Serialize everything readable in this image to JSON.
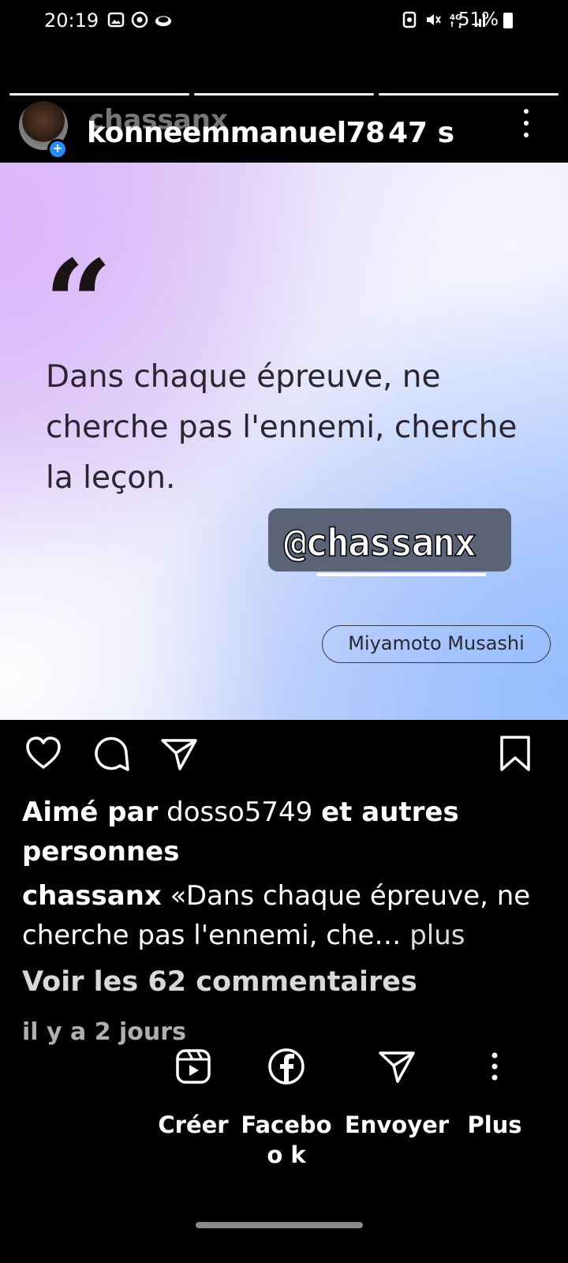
{
  "status_bar": {
    "time": "20:19",
    "battery": "51%",
    "network": "4G",
    "left_icons": [
      "gallery-icon",
      "chrome-icon",
      "cloud-icon"
    ],
    "right_icons": [
      "data-saver-icon",
      "mute-icon",
      "network-4g-icon",
      "signal-icon",
      "battery-icon"
    ]
  },
  "story": {
    "progress_segments": 3,
    "progress_done": 3,
    "ghost_username": "chassanx",
    "username": "konneemmanuel78",
    "elapsed": "47 s",
    "avatar_badge": "+"
  },
  "post": {
    "quote_mark": "“",
    "quote": "Dans chaque épreuve, ne cherche pas l'ennemi, cherche la leçon.",
    "author": "Miyamoto Musashi",
    "mention": "@chassanx"
  },
  "actions": [
    "heart-icon",
    "comment-icon",
    "share-icon",
    "bookmark-icon"
  ],
  "likes": {
    "prefix": "Aimé par",
    "user": "dosso5749",
    "suffix": "et autres personnes"
  },
  "caption": {
    "user": "chassanx",
    "text": "«Dans chaque épreuve, ne cherche pas l'ennemi, che…",
    "more": "plus"
  },
  "comments_link": "Voir les 62 commentaires",
  "timestamp": "il y a 2 jours",
  "share_sheet": [
    {
      "label": "Créer",
      "icon": "reels-icon"
    },
    {
      "label": "Faceboo k",
      "icon": "facebook-icon"
    },
    {
      "label": "Envoyer",
      "icon": "send-icon"
    },
    {
      "label": "Plus",
      "icon": "more-icon"
    }
  ],
  "colors": {
    "background": "#000000",
    "badge_blue": "#2a8af6",
    "quote_text": "#2b2530",
    "sticker_bg": "#5b6376"
  }
}
